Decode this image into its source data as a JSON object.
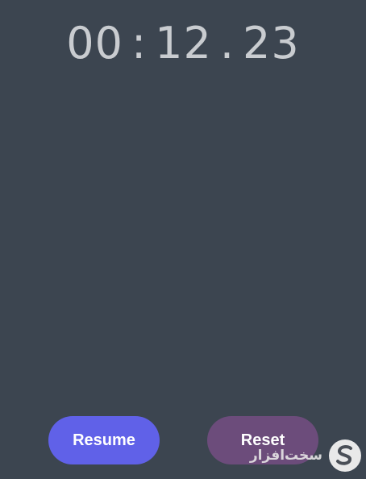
{
  "stopwatch": {
    "minutes": "00",
    "sep1": ":",
    "seconds": "12",
    "sep2": ".",
    "centiseconds": "23"
  },
  "buttons": {
    "resume_label": "Resume",
    "reset_label": "Reset"
  },
  "watermark": {
    "text": "سخت‌افزار",
    "logo_icon": "s-logo-icon"
  },
  "colors": {
    "background": "#3c4550",
    "time_text": "#c9ccd0",
    "resume_button": "#6061e8",
    "reset_button": "#6c4c7b"
  }
}
